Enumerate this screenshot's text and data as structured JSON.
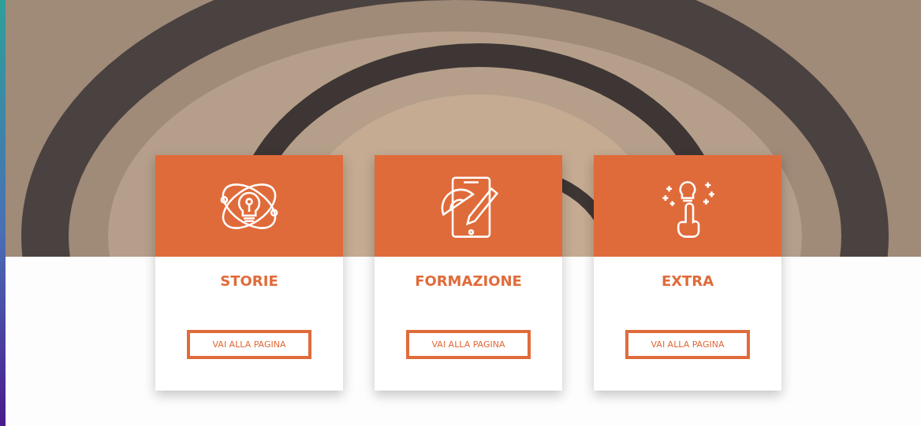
{
  "cards": [
    {
      "title": "STORIE",
      "button": "VAI ALLA PAGINA"
    },
    {
      "title": "FORMAZIONE",
      "button": "VAI ALLA PAGINA"
    },
    {
      "title": "EXTRA",
      "button": "VAI ALLA PAGINA"
    }
  ]
}
